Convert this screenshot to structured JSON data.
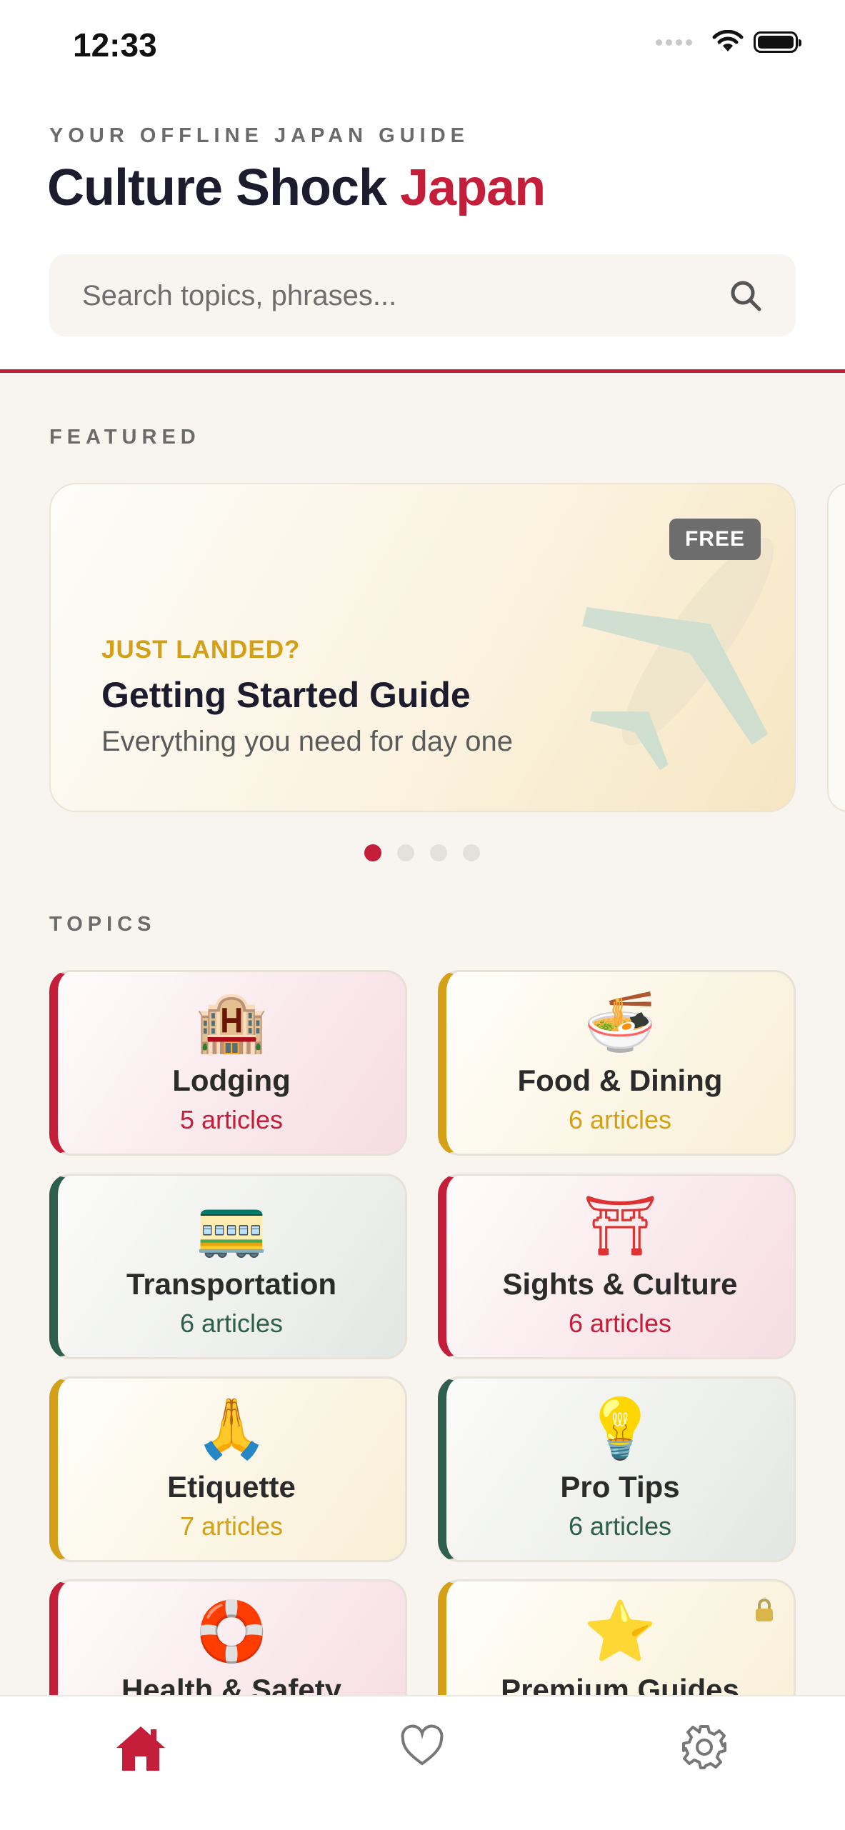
{
  "status_bar": {
    "time": "12:33"
  },
  "header": {
    "overline": "YOUR OFFLINE JAPAN GUIDE",
    "title_main": "Culture Shock",
    "title_accent": "Japan"
  },
  "search": {
    "placeholder": "Search topics, phrases..."
  },
  "featured": {
    "section_label": "FEATURED",
    "card": {
      "badge": "FREE",
      "overline": "JUST LANDED?",
      "title": "Getting Started Guide",
      "subtitle": "Everything you need for day one",
      "image_icon": "airplane-icon"
    },
    "page_count": 4,
    "active_page": 1
  },
  "topics": {
    "section_label": "TOPICS",
    "items": [
      {
        "emoji": "🏨",
        "icon": "hotel-icon",
        "title": "Lodging",
        "count": "5 articles",
        "accent": "#c41e3a"
      },
      {
        "emoji": "🍜",
        "icon": "noodle-bowl-icon",
        "title": "Food & Dining",
        "count": "6 articles",
        "accent": "#d4a017"
      },
      {
        "emoji": "🚃",
        "icon": "train-icon",
        "title": "Transportation",
        "count": "6 articles",
        "accent": "#2e5e4e"
      },
      {
        "emoji": "⛩",
        "icon": "torii-gate-icon",
        "title": "Sights & Culture",
        "count": "6 articles",
        "accent": "#c41e3a"
      },
      {
        "emoji": "🙏",
        "icon": "folded-hands-icon",
        "title": "Etiquette",
        "count": "7 articles",
        "accent": "#d4a017"
      },
      {
        "emoji": "💡",
        "icon": "light-bulb-icon",
        "title": "Pro Tips",
        "count": "6 articles",
        "accent": "#2e5e4e"
      },
      {
        "emoji": "🛟",
        "icon": "lifebuoy-icon",
        "title": "Health & Safety",
        "count": "",
        "accent": "#c41e3a"
      },
      {
        "emoji": "⭐",
        "icon": "star-icon",
        "title": "Premium Guides",
        "count": "",
        "accent": "#d4a017",
        "locked": true
      }
    ]
  },
  "tab_bar": {
    "tabs": [
      {
        "name": "home",
        "icon": "home-icon",
        "active": true
      },
      {
        "name": "favorites",
        "icon": "heart-icon",
        "active": false
      },
      {
        "name": "settings",
        "icon": "gear-icon",
        "active": false
      }
    ]
  },
  "colors": {
    "accent_red": "#c41e3a",
    "accent_gold": "#d4a017",
    "accent_green": "#2e5e4e",
    "background": "#f8f5f0"
  }
}
